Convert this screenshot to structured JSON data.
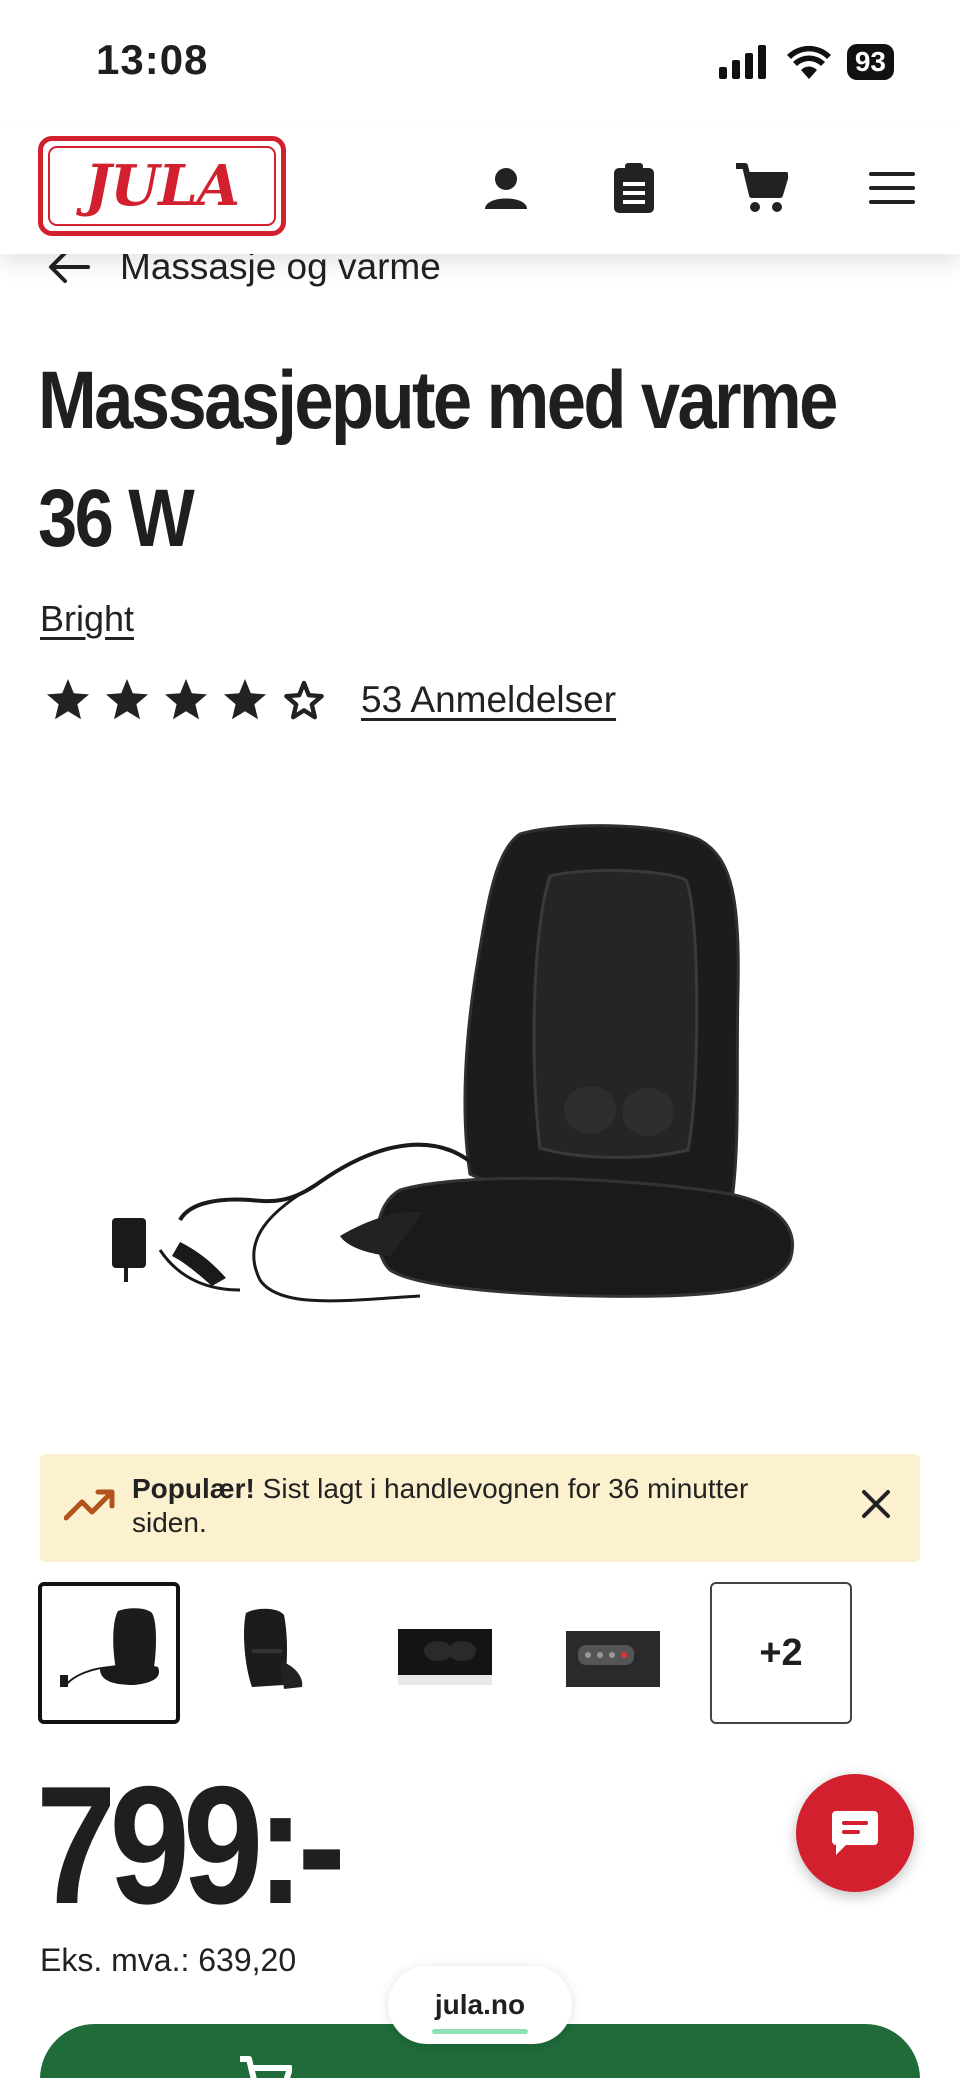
{
  "status_bar": {
    "time": "13:08",
    "battery": "93"
  },
  "header": {
    "logo_text": "JULA",
    "icons": [
      "account-icon",
      "clipboard-list-icon",
      "cart-icon",
      "menu-icon"
    ]
  },
  "breadcrumb": {
    "label": "Massasje og varme"
  },
  "product": {
    "title_line1": "Massasjepute med varme",
    "title_line2": "36 W",
    "brand": "Bright",
    "rating": 4,
    "rating_max": 5,
    "reviews": "53 Anmeldelser"
  },
  "popular_banner": {
    "bold": "Populær!",
    "text": " Sist lagt i handlevognen for 36 minutter siden."
  },
  "thumbnails": {
    "more_label": "+2"
  },
  "price": {
    "value": "799:-",
    "vat": "Eks. mva.: 639,20"
  },
  "browser": {
    "domain": "jula.no"
  },
  "colors": {
    "brand_red": "#d2202f",
    "banner_bg": "#fbf1cf",
    "cart_green": "#1f6b3a"
  }
}
